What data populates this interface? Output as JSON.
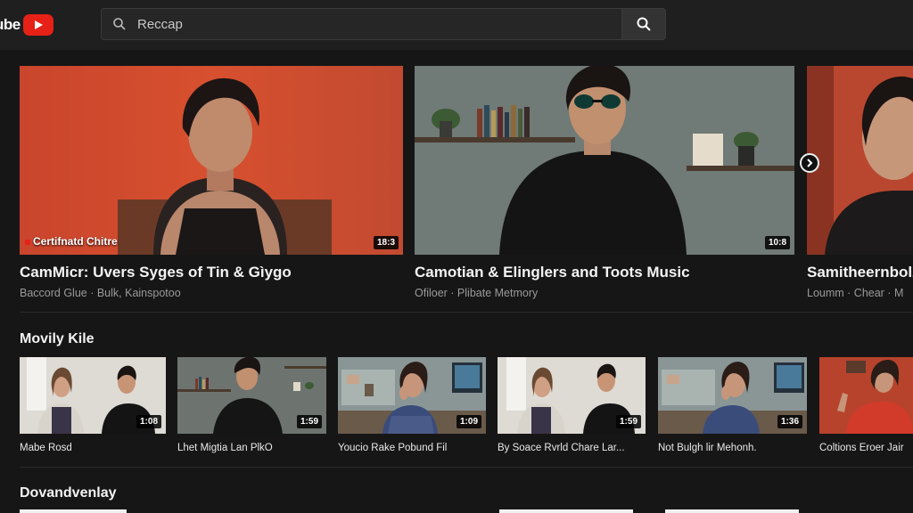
{
  "header": {
    "logo_text": "ube",
    "search": {
      "value": "Reccap",
      "placeholder": ""
    }
  },
  "featured": [
    {
      "title": "CamMicr: Uvers Syges of Tin & Gìygo",
      "meta": "Baccord Glue · Bulk, Kainspotoo",
      "duration": "18:3",
      "caption": "Certifnatd Chitre"
    },
    {
      "title": "Camotian & Elinglers and Toots Music",
      "meta": "Ofiloer · Plibate Metmory",
      "duration": "10:8",
      "caption": ""
    },
    {
      "title": "Samitheernbolz",
      "meta": "Loumm · Chear · M",
      "duration": "",
      "caption": ""
    }
  ],
  "section1": {
    "title": "Movily Kile",
    "items": [
      {
        "title": "Mabe Rosd",
        "duration": "1:08"
      },
      {
        "title": "Lhet Migtia Lan PlkO",
        "duration": "1:59"
      },
      {
        "title": "Youcio Rake Pobund Fil",
        "duration": "1:09"
      },
      {
        "title": "By Soace Rvrld Chare Lar...",
        "duration": "1:59"
      },
      {
        "title": "Not Bulgh lir Mehonh.",
        "duration": "1:36"
      },
      {
        "title": "Coltions Eroer Jair",
        "duration": ""
      }
    ]
  },
  "section2": {
    "title": "Dovandvenlay"
  },
  "colors": {
    "brand": "#e62117",
    "background": "#161616",
    "topbar": "#1f1f1f"
  }
}
